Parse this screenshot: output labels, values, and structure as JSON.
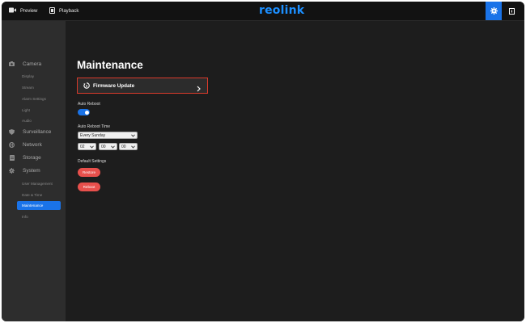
{
  "topbar": {
    "tabs": [
      {
        "label": "Preview",
        "icon": "video-camera-icon"
      },
      {
        "label": "Playback",
        "icon": "film-icon"
      }
    ],
    "brand": "reolink",
    "settings_icon": "gear-icon",
    "exit_icon": "exit-icon"
  },
  "sidebar": {
    "sections": [
      {
        "label": "Camera",
        "icon": "camera-icon",
        "items": [
          "Display",
          "Stream",
          "Alarm Settings",
          "Light",
          "Audio"
        ]
      },
      {
        "label": "Surveillance",
        "icon": "shield-icon",
        "items": []
      },
      {
        "label": "Network",
        "icon": "globe-icon",
        "items": []
      },
      {
        "label": "Storage",
        "icon": "storage-icon",
        "items": []
      },
      {
        "label": "System",
        "icon": "gear-icon",
        "items": [
          "User Management",
          "Date & Time",
          "Maintenance",
          "Info"
        ]
      }
    ],
    "active_item": "Maintenance"
  },
  "main": {
    "title": "Maintenance",
    "firmware": {
      "label": "Firmware Update",
      "icon": "firmware-update-icon"
    },
    "auto_reboot": {
      "label": "Auto Reboot",
      "enabled": true
    },
    "auto_reboot_time": {
      "label": "Auto Reboot Time",
      "day": "Every Sunday",
      "hour": "02",
      "minute": "00",
      "second": "00"
    },
    "default_settings": {
      "label": "Default Settings",
      "restore_label": "Restore",
      "reboot_label": "Reboot"
    }
  },
  "colors": {
    "accent": "#1a73e8",
    "brand": "#1c8fff",
    "danger": "#e8504c",
    "highlight_border": "#d93a2b"
  }
}
